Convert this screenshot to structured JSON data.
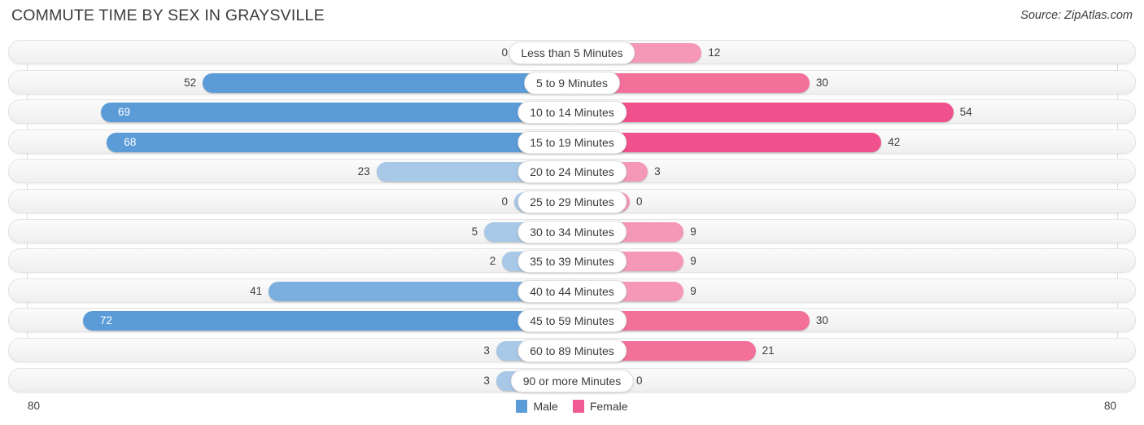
{
  "header": {
    "title": "COMMUTE TIME BY SEX IN GRAYSVILLE",
    "source": "Source: ZipAtlas.com"
  },
  "axis": {
    "left_cap": "80",
    "right_cap": "80",
    "max": 80
  },
  "legend": {
    "items": [
      {
        "label": "Male",
        "color": "#5b9bd8"
      },
      {
        "label": "Female",
        "color": "#ef5b92"
      }
    ]
  },
  "colors": {
    "male_strong": "#5b9bd8",
    "male_medium": "#7aafdf",
    "male_light": "#a8c8e8",
    "female_strong": "#f0508c",
    "female_medium": "#f27099",
    "female_light": "#f598b8",
    "row_track": "#f5f5f5",
    "text": "#3c3c3c"
  },
  "chart_data": {
    "type": "bar",
    "title": "COMMUTE TIME BY SEX IN GRAYSVILLE",
    "subtitle": "",
    "xlabel": "",
    "ylabel": "",
    "orientation": "horizontal-diverging",
    "legend_position": "bottom-center",
    "grid": true,
    "xlim": [
      80,
      80
    ],
    "categories": [
      "Less than 5 Minutes",
      "5 to 9 Minutes",
      "10 to 14 Minutes",
      "15 to 19 Minutes",
      "20 to 24 Minutes",
      "25 to 29 Minutes",
      "30 to 34 Minutes",
      "35 to 39 Minutes",
      "40 to 44 Minutes",
      "45 to 59 Minutes",
      "60 to 89 Minutes",
      "90 or more Minutes"
    ],
    "series": [
      {
        "name": "Male",
        "side": "left",
        "values": [
          0,
          52,
          69,
          68,
          23,
          0,
          5,
          2,
          41,
          72,
          3,
          3
        ]
      },
      {
        "name": "Female",
        "side": "right",
        "values": [
          12,
          30,
          54,
          42,
          3,
          0,
          9,
          9,
          9,
          30,
          21,
          0
        ]
      }
    ]
  }
}
